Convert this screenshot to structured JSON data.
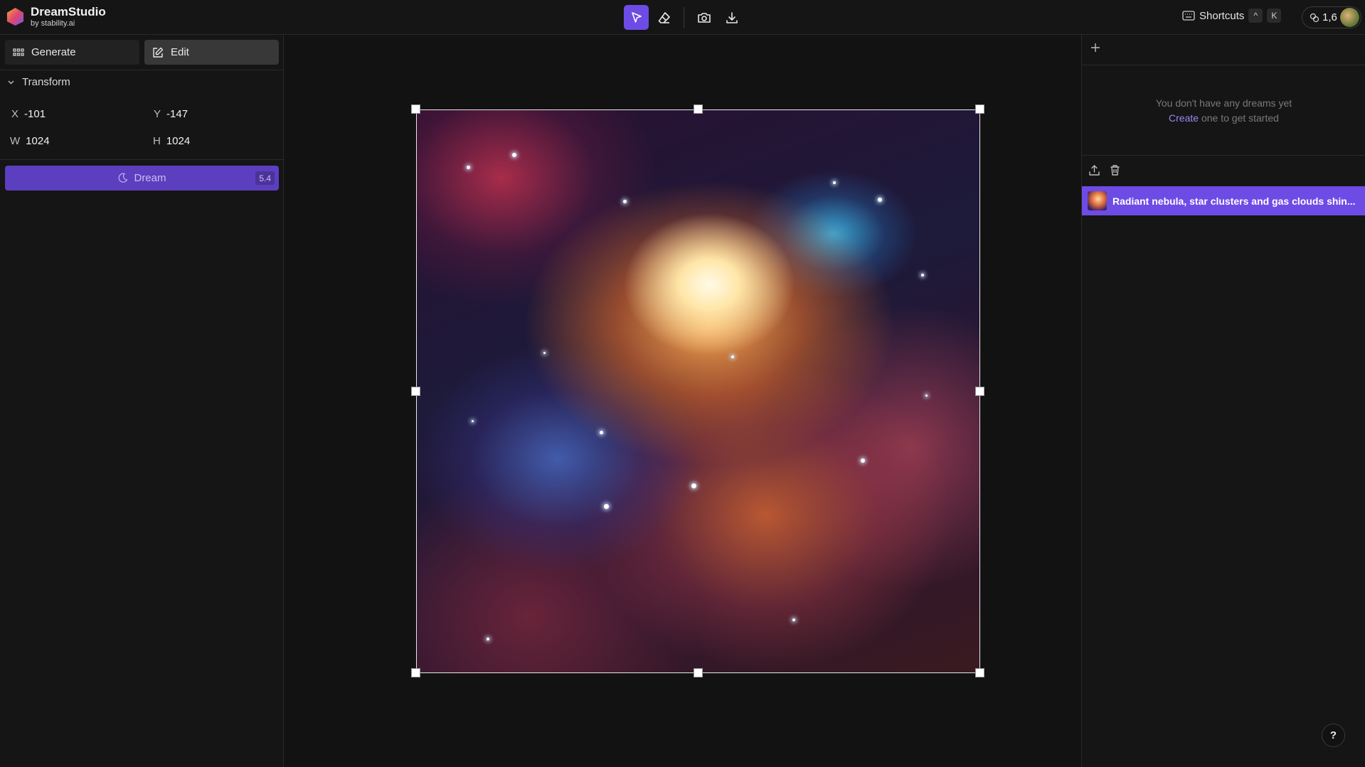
{
  "app": {
    "title": "DreamStudio",
    "subtitle": "by stability.ai"
  },
  "toolbar": {
    "tools": [
      {
        "name": "select",
        "icon": "cursor-icon",
        "active": true
      },
      {
        "name": "erase",
        "icon": "eraser-icon",
        "active": false
      },
      {
        "name": "snapshot",
        "icon": "camera-icon",
        "active": false
      },
      {
        "name": "download",
        "icon": "download-icon",
        "active": false
      }
    ],
    "shortcuts_label": "Shortcuts",
    "shortcut_keys": [
      "^",
      "K"
    ],
    "credits": "1,6"
  },
  "left_panel": {
    "tabs": [
      {
        "label": "Generate",
        "active": false
      },
      {
        "label": "Edit",
        "active": true
      }
    ],
    "section_title": "Transform",
    "transform": {
      "x_label": "X",
      "x_value": "-101",
      "y_label": "Y",
      "y_value": "-147",
      "w_label": "W",
      "w_value": "1024",
      "h_label": "H",
      "h_value": "1024"
    },
    "dream_button": {
      "label": "Dream",
      "cost": "5.4"
    }
  },
  "canvas": {
    "image_description_icon": "nebula-image"
  },
  "right_panel": {
    "empty_line1": "You don't have any dreams yet",
    "empty_link": "Create",
    "empty_line2_rest": " one to get started",
    "items": [
      {
        "title": "Radiant nebula, star clusters and gas clouds shin..."
      }
    ]
  },
  "help_label": "?",
  "colors": {
    "accent": "#6d4ce6",
    "dream_button": "#5b3fbf",
    "background": "#121212"
  }
}
